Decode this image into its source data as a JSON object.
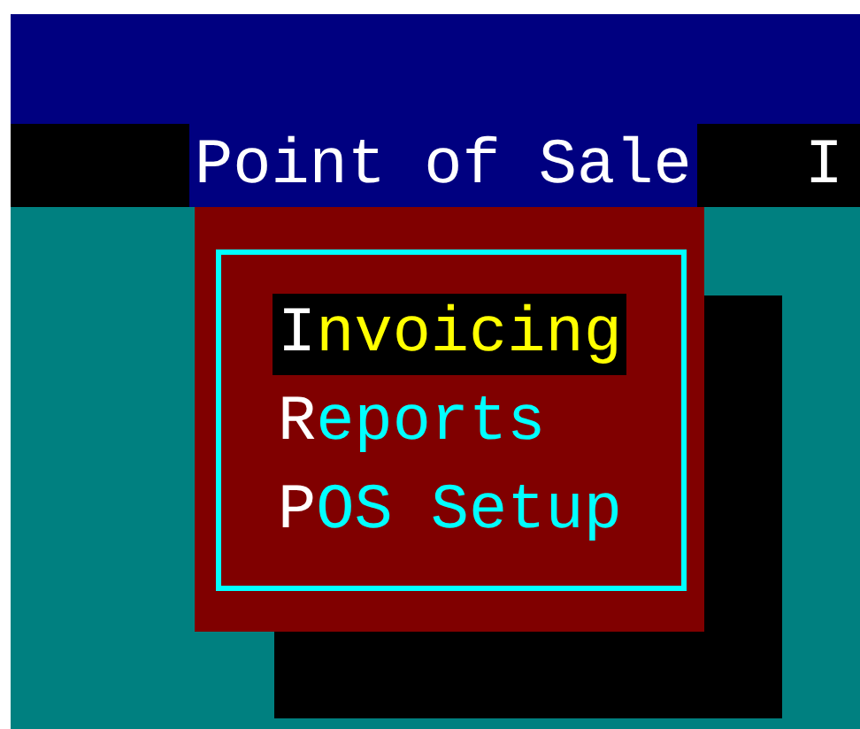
{
  "menu_bar": [
    {
      "label": "Point of Sale",
      "selected": true
    },
    {
      "label": "I",
      "selected": false
    }
  ],
  "dropdown": {
    "items": [
      {
        "label": "Invoicing",
        "selected": true
      },
      {
        "label": "Reports",
        "selected": false
      },
      {
        "label": "POS Setup",
        "selected": false
      }
    ]
  }
}
